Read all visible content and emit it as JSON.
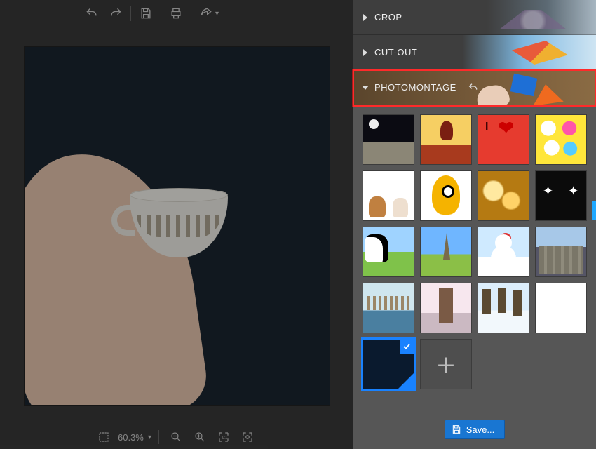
{
  "toolbar": {
    "zoom_level": "60.3%"
  },
  "panels": {
    "crop": {
      "label": "CROP"
    },
    "cutout": {
      "label": "CUT-OUT"
    },
    "photomontage": {
      "label": "PHOTOMONTAGE"
    }
  },
  "statusbar": {
    "zoom_level": "60.3%"
  },
  "save": {
    "label": "Save..."
  },
  "templates": [
    {
      "id": "moon-surface"
    },
    {
      "id": "autumn-tree"
    },
    {
      "id": "i-love"
    },
    {
      "id": "comic-bubbles"
    },
    {
      "id": "pets"
    },
    {
      "id": "cartoon-monster"
    },
    {
      "id": "golden-bokeh"
    },
    {
      "id": "sparkler-dark"
    },
    {
      "id": "cow-field"
    },
    {
      "id": "eiffel-grass"
    },
    {
      "id": "snowman"
    },
    {
      "id": "city-skyline"
    },
    {
      "id": "harbor"
    },
    {
      "id": "cherry-blossom"
    },
    {
      "id": "winter-trees"
    },
    {
      "id": "plain-white"
    },
    {
      "id": "dark-folded-corner",
      "selected": true
    },
    {
      "id": "add-custom",
      "add": true
    }
  ]
}
